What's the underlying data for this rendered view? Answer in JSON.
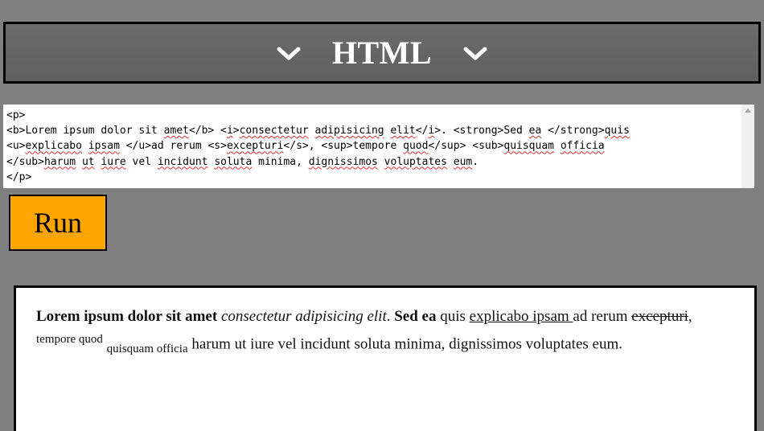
{
  "header": {
    "title": "HTML",
    "left_icon": "chevron-down-icon",
    "right_icon": "chevron-down-icon"
  },
  "editor": {
    "lines": [
      [
        {
          "t": "<p>"
        }
      ],
      [
        {
          "t": "<b>Lorem ipsum dolor sit "
        },
        {
          "t": "amet",
          "sq": true
        },
        {
          "t": "</b> <"
        },
        {
          "t": "i",
          "sq": true
        },
        {
          "t": ">"
        },
        {
          "t": "consectetur",
          "sq": true
        },
        {
          "t": " "
        },
        {
          "t": "adipisicing",
          "sq": true
        },
        {
          "t": " "
        },
        {
          "t": "elit",
          "sq": true
        },
        {
          "t": "</"
        },
        {
          "t": "i",
          "sq": true
        },
        {
          "t": ">. <strong>Sed "
        },
        {
          "t": "ea",
          "sq": true
        },
        {
          "t": " </strong>"
        },
        {
          "t": "quis",
          "sq": true
        }
      ],
      [
        {
          "t": "<u>"
        },
        {
          "t": "explicabo",
          "sq": true
        },
        {
          "t": " "
        },
        {
          "t": "ipsam",
          "sq": true
        },
        {
          "t": " </u>ad rerum <s>"
        },
        {
          "t": "excepturi",
          "sq": true
        },
        {
          "t": "</s>, <sup>tempore "
        },
        {
          "t": "quod",
          "sq": true
        },
        {
          "t": "</sup> <sub>"
        },
        {
          "t": "quisquam",
          "sq": true
        },
        {
          "t": " "
        },
        {
          "t": "officia",
          "sq": true
        }
      ],
      [
        {
          "t": "</sub>"
        },
        {
          "t": "harum",
          "sq": true
        },
        {
          "t": " "
        },
        {
          "t": "ut",
          "sq": true
        },
        {
          "t": " "
        },
        {
          "t": "iure",
          "sq": true
        },
        {
          "t": " vel "
        },
        {
          "t": "incidunt",
          "sq": true
        },
        {
          "t": " "
        },
        {
          "t": "soluta",
          "sq": true
        },
        {
          "t": " minima, "
        },
        {
          "t": "dignissimos",
          "sq": true
        },
        {
          "t": " "
        },
        {
          "t": "voluptates",
          "sq": true
        },
        {
          "t": " "
        },
        {
          "t": "eum",
          "sq": true
        },
        {
          "t": "."
        }
      ],
      [
        {
          "t": "</p>"
        }
      ]
    ]
  },
  "run_button": {
    "label": "Run"
  },
  "output": {
    "bold": "Lorem ipsum dolor sit amet",
    "italic": "consectetur adipisicing elit",
    "after_italic": ". ",
    "strong": "Sed ea",
    "plain1": " quis ",
    "underline": "explicabo ipsam ",
    "plain2": "ad rerum ",
    "strike": "excepturi",
    "plain3": ", ",
    "sup": "tempore quod",
    "plain4": " ",
    "sub": "quisquam officia",
    "plain5": " harum ut iure vel incidunt soluta minima, dignissimos voluptates eum."
  }
}
